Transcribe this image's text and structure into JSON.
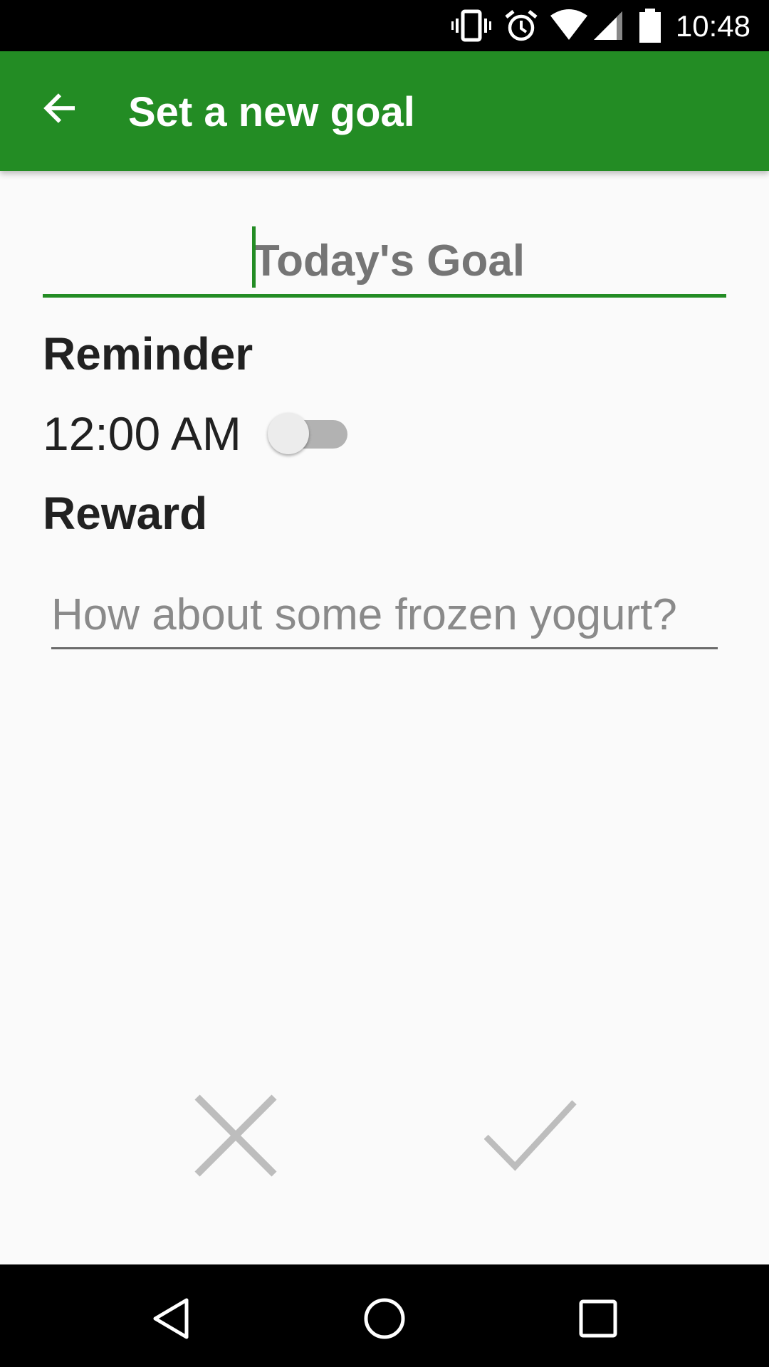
{
  "status_bar": {
    "time": "10:48",
    "icons": [
      "vibrate-icon",
      "alarm-icon",
      "wifi-icon",
      "signal-icon",
      "battery-icon"
    ]
  },
  "app_bar": {
    "title": "Set a new goal",
    "back_icon": "arrow-back-icon",
    "color": "#238c24"
  },
  "goal": {
    "placeholder": "Today's Goal",
    "value": ""
  },
  "reminder": {
    "label": "Reminder",
    "time": "12:00 AM",
    "enabled": false
  },
  "reward": {
    "label": "Reward",
    "placeholder": "How about some frozen yogurt?",
    "value": ""
  },
  "actions": {
    "cancel_icon": "close-icon",
    "confirm_icon": "check-icon"
  },
  "nav_bar": {
    "icons": [
      "back-triangle-icon",
      "home-circle-icon",
      "recents-square-icon"
    ]
  },
  "colors": {
    "accent": "#238c24",
    "background": "#fafafa",
    "text_primary": "#212121",
    "hint": "#757575"
  }
}
